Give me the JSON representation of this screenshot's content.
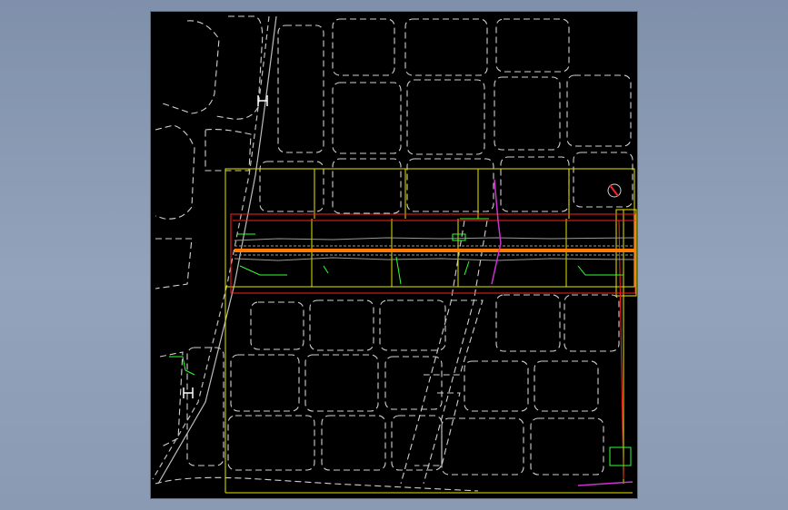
{
  "colors": {
    "viewer_background": "#8b9bb4",
    "drawing_background": "#000000",
    "block_outlines": "#cfcfcf",
    "boundary_yellow": "#e6e600",
    "redline": "#ff2020",
    "route_orange": "#ff7a00",
    "annotation_green": "#33ff33",
    "magenta_line": "#cc33cc"
  },
  "icons": {
    "north_arrow": "north-arrow-icon"
  }
}
